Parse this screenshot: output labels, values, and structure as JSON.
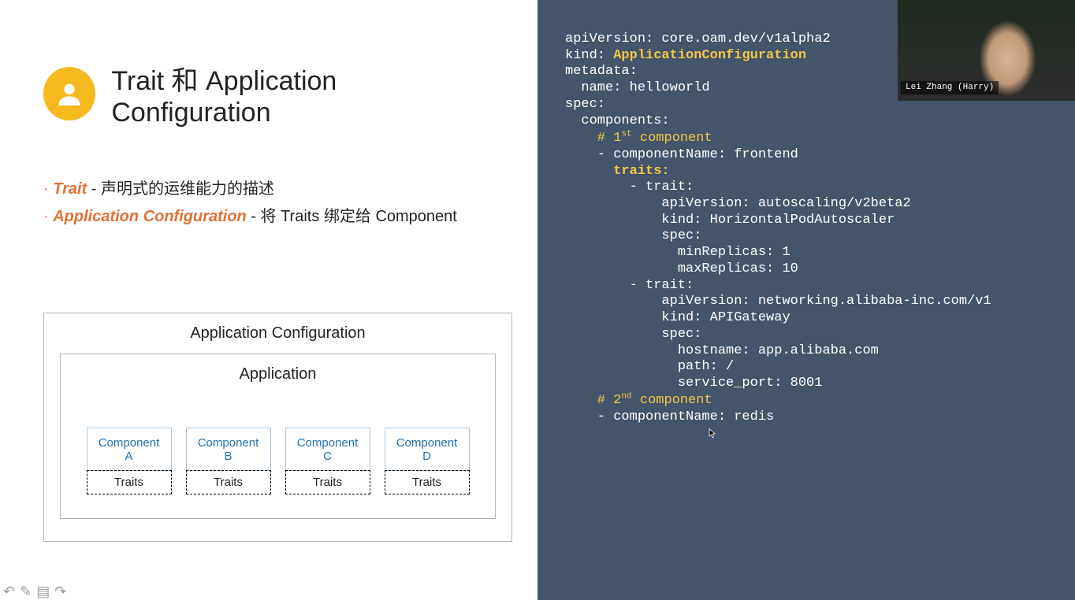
{
  "slide": {
    "title": "Trait 和 Application Configuration",
    "bullets": [
      {
        "term": "Trait",
        "text": "声明式的运维能力的描述"
      },
      {
        "term": "Application Configuration",
        "text": "将 Traits 绑定给 Component"
      }
    ],
    "diagram": {
      "outer_title": "Application Configuration",
      "app_title": "Application",
      "components": [
        {
          "name_line1": "Component",
          "name_line2": "A",
          "traits": "Traits"
        },
        {
          "name_line1": "Component",
          "name_line2": "B",
          "traits": "Traits"
        },
        {
          "name_line1": "Component",
          "name_line2": "C",
          "traits": "Traits"
        },
        {
          "name_line1": "Component",
          "name_line2": "D",
          "traits": "Traits"
        }
      ]
    }
  },
  "yaml": {
    "l01": "apiVersion: core.oam.dev/v1alpha2",
    "l02a": "kind: ",
    "l02b": "ApplicationConfiguration",
    "l03": "metadata:",
    "l04": "  name: helloworld",
    "l05": "spec:",
    "l06": "  components:",
    "l07a": "    # 1",
    "l07b": "st",
    "l07c": " component",
    "l08": "    - componentName: frontend",
    "l09": "      traits:",
    "l10": "        - trait:",
    "l11": "            apiVersion: autoscaling/v2beta2",
    "l12": "            kind: HorizontalPodAutoscaler",
    "l13": "            spec:",
    "l14": "              minReplicas: 1",
    "l15": "              maxReplicas: 10",
    "l16": "        - trait:",
    "l17": "            apiVersion: networking.alibaba-inc.com/v1",
    "l18": "            kind: APIGateway",
    "l19": "            spec:",
    "l20": "              hostname: app.alibaba.com",
    "l21": "              path: /",
    "l22": "              service_port: 8001",
    "l23a": "    # 2",
    "l23b": "nd",
    "l23c": " component",
    "l24": "    - componentName: redis"
  },
  "presenter": {
    "name": "Lei Zhang (Harry)"
  }
}
